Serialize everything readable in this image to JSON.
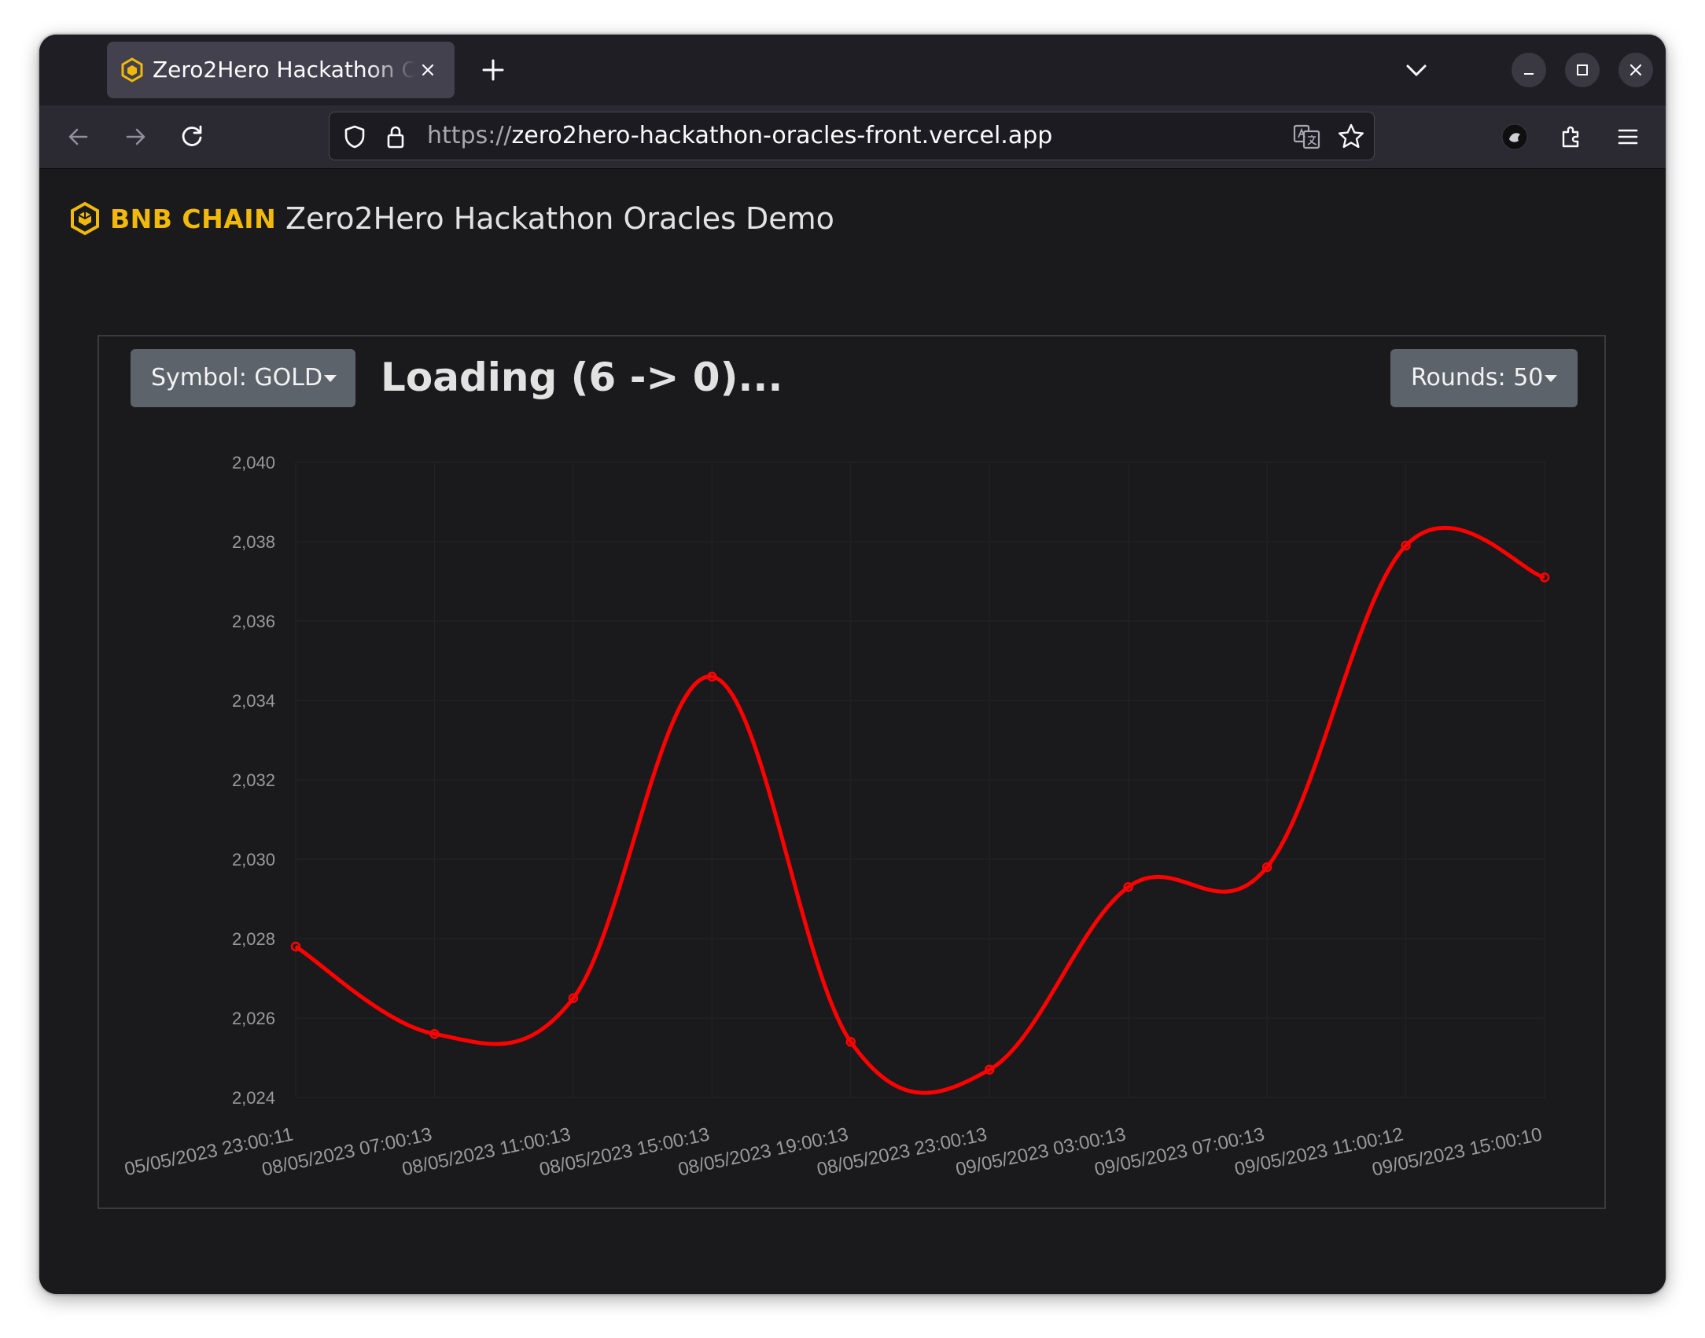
{
  "browser": {
    "tab_title": "Zero2Hero Hackathon Oracles Demo",
    "url_scheme": "https://",
    "url_host": "zero2hero-hackathon-oracles-front.vercel.app"
  },
  "header": {
    "brand": "BNB CHAIN",
    "title": "Zero2Hero Hackathon Oracles Demo"
  },
  "controls": {
    "symbol_label": "Symbol: GOLD",
    "status": "Loading (6 -> 0)...",
    "rounds_label": "Rounds: 50"
  },
  "colors": {
    "brand": "#f0b90b",
    "series": "#ff0000",
    "button": "#5c636a"
  },
  "chart_data": {
    "type": "line",
    "title": "",
    "xlabel": "",
    "ylabel": "",
    "ylim": [
      2024,
      2040
    ],
    "yticks": [
      "2,024",
      "2,026",
      "2,028",
      "2,030",
      "2,032",
      "2,034",
      "2,036",
      "2,038",
      "2,040"
    ],
    "x": [
      "05/05/2023 23:00:11",
      "08/05/2023 07:00:13",
      "08/05/2023 11:00:13",
      "08/05/2023 15:00:13",
      "08/05/2023 19:00:13",
      "08/05/2023 23:00:13",
      "09/05/2023 03:00:13",
      "09/05/2023 07:00:13",
      "09/05/2023 11:00:12",
      "09/05/2023 15:00:10"
    ],
    "series": [
      {
        "name": "",
        "color": "#ff0000",
        "values": [
          2027.8,
          2025.6,
          2026.5,
          2034.6,
          2025.4,
          2024.7,
          2029.3,
          2029.8,
          2037.9,
          2037.1
        ]
      }
    ],
    "grid": true,
    "legend": "none"
  }
}
